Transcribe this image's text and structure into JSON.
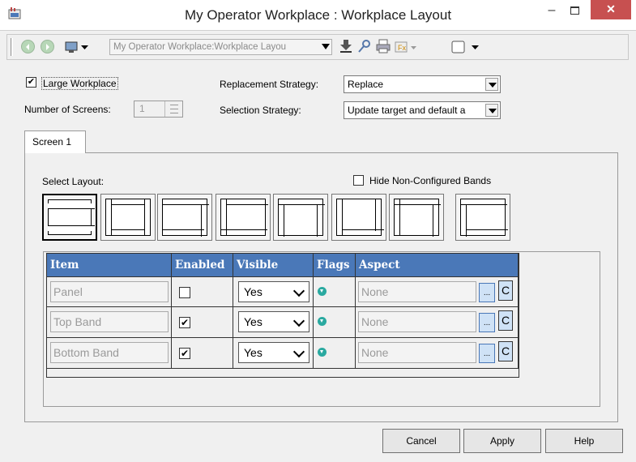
{
  "window": {
    "title": "My Operator Workplace : Workplace Layout",
    "minimize": "–",
    "close": "✕"
  },
  "toolbar": {
    "path": "My Operator Workplace:Workplace Layou"
  },
  "form": {
    "large_workplace_label": "Large Workplace",
    "large_workplace_checked": "✔",
    "number_of_screens_label": "Number of Screens:",
    "number_of_screens_value": "1",
    "replacement_strategy_label": "Replacement Strategy:",
    "replacement_strategy_value": "Replace",
    "selection_strategy_label": "Selection Strategy:",
    "selection_strategy_value": "Update target and default a"
  },
  "tabs": [
    {
      "label": "Screen 1"
    }
  ],
  "layout": {
    "select_label": "Select Layout:",
    "hide_bands_label": "Hide Non-Configured Bands"
  },
  "grid": {
    "headers": [
      "Item",
      "Enabled",
      "Visible",
      "Flags",
      "Aspect"
    ],
    "rows": [
      {
        "item": "Panel",
        "enabled": "",
        "visible": "Yes",
        "aspect": "None",
        "ellipsis": "...",
        "c": "C"
      },
      {
        "item": "Top Band",
        "enabled": "✔",
        "visible": "Yes",
        "aspect": "None",
        "ellipsis": "...",
        "c": "C"
      },
      {
        "item": "Bottom Band",
        "enabled": "✔",
        "visible": "Yes",
        "aspect": "None",
        "ellipsis": "...",
        "c": "C"
      }
    ]
  },
  "buttons": {
    "cancel": "Cancel",
    "apply": "Apply",
    "help": "Help"
  },
  "colors": {
    "header_blue": "#4a78b8",
    "close_red": "#c75050",
    "flag_teal": "#2aa9a0"
  }
}
